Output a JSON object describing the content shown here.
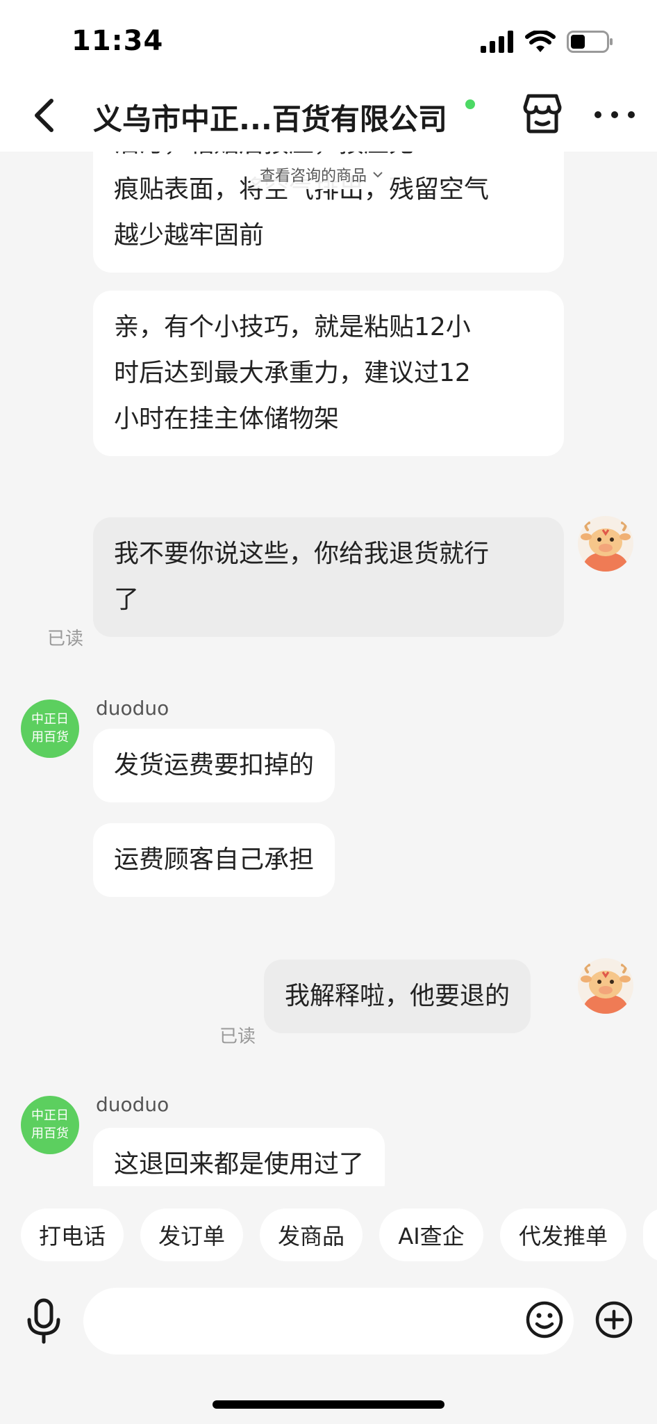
{
  "status_bar": {
    "time": "11:34"
  },
  "nav": {
    "title": "义乌市中正...百货有限公司",
    "online_color": "#4cd964"
  },
  "consult_pill": {
    "label": "查看咨询的商品"
  },
  "messages": [
    {
      "side": "in",
      "lines": [
        "油污，粘贴后按压，按压无",
        "痕贴表面，将空气排出，残留空气",
        "越少越牢固前"
      ]
    },
    {
      "side": "in",
      "lines": [
        "亲，有个小技巧，就是粘贴12小",
        "时后达到最大承重力，建议过12",
        "小时在挂主体储物架"
      ]
    },
    {
      "side": "out",
      "lines": [
        "我不要你说这些，你给我退货就行",
        "了"
      ],
      "status": "已读"
    },
    {
      "side": "in",
      "sender": "duoduo",
      "avatar_text": [
        "中正日",
        "用百货"
      ],
      "lines": [
        "发货运费要扣掉的"
      ]
    },
    {
      "side": "in",
      "lines": [
        "运费顾客自己承担"
      ]
    },
    {
      "side": "out",
      "lines": [
        "我解释啦，他要退的"
      ],
      "status": "已读"
    },
    {
      "side": "in",
      "sender": "duoduo",
      "avatar_text": [
        "中正日",
        "用百货"
      ],
      "lines": [
        "这退回来都是使用过了"
      ]
    }
  ],
  "quick_actions": [
    "打电话",
    "发订单",
    "发商品",
    "AI查企",
    "代发推单"
  ],
  "input": {
    "placeholder": ""
  },
  "colors": {
    "shop_avatar": "#5ccf5f",
    "self_avatar_bg": "#f7efe6",
    "self_avatar_body": "#ef7b55"
  }
}
